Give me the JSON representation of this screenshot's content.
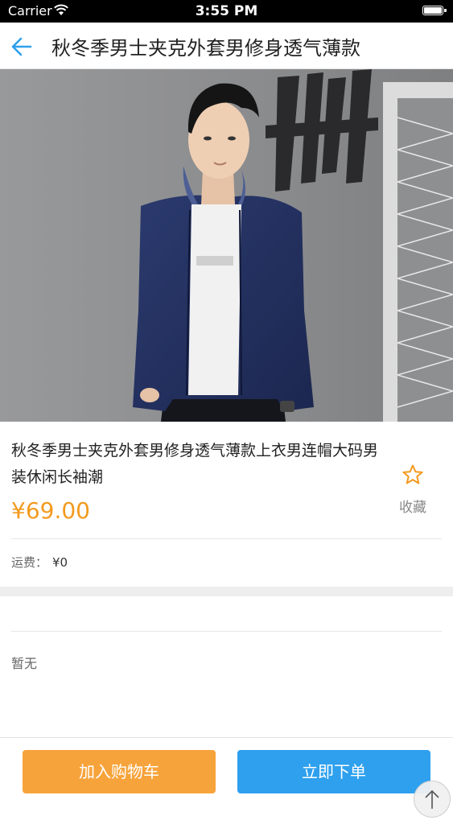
{
  "status_bar": {
    "carrier": "Carrier",
    "time": "3:55 PM"
  },
  "nav": {
    "title": "秋冬季男士夹克外套男修身透气薄款"
  },
  "product": {
    "name": "秋冬季男士夹克外套男修身透气薄款上衣男连帽大码男装休闲长袖潮",
    "price": "¥69.00",
    "favorite_label": "收藏",
    "shipping_label": "运费：",
    "shipping_value": "¥0",
    "description": "暂无"
  },
  "actions": {
    "add_to_cart": "加入购物车",
    "buy_now": "立即下单"
  },
  "colors": {
    "accent_blue": "#2ea0ee",
    "price_orange": "#f39a1f",
    "cart_orange": "#f7a33b"
  },
  "icons": {
    "back": "back-arrow-icon",
    "favorite": "star-outline-icon",
    "scroll_top": "arrow-up-icon"
  }
}
